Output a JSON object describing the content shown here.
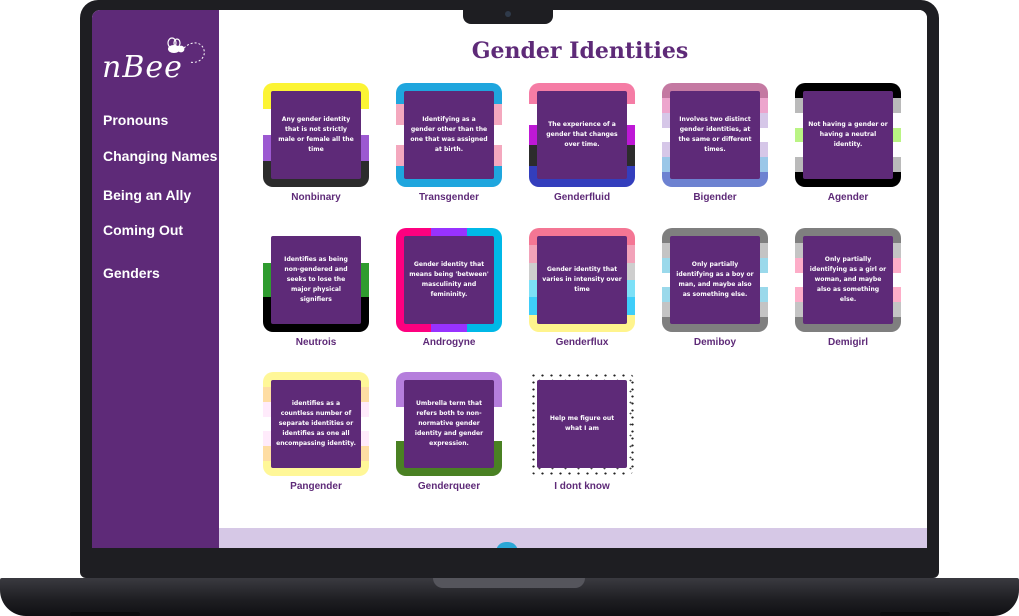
{
  "brand": {
    "logo_text": "nBee"
  },
  "nav": {
    "items": [
      {
        "label": "Pronouns"
      },
      {
        "label": "Changing Names"
      },
      {
        "label": "Being an Ally"
      },
      {
        "label": "Coming Out"
      },
      {
        "label": "Genders"
      }
    ]
  },
  "page": {
    "title": "Gender Identities"
  },
  "colors": {
    "purple": "#5e2a78",
    "footer": "#d6c8e6"
  },
  "cards": [
    {
      "label": "Nonbinary",
      "description": "Any gender identity that is not strictly male or female all the time",
      "flag": [
        "#fcf434",
        "#ffffff",
        "#9c59d1",
        "#2c2c2c"
      ]
    },
    {
      "label": "Transgender",
      "description": "Identifying as a gender other than the one that was assigned at birth.",
      "flag": [
        "#1fa6de",
        "#f4a8be",
        "#ffffff",
        "#f4a8be",
        "#1fa6de"
      ]
    },
    {
      "label": "Genderfluid",
      "description": "The experience of a gender that changes over time.",
      "flag": [
        "#f57ca5",
        "#ffffff",
        "#be18d6",
        "#2c2c2c",
        "#333ebd"
      ]
    },
    {
      "label": "Bigender",
      "description": "Involves two distinct gender identities, at the same or different times.",
      "flag": [
        "#c479a2",
        "#eda5cd",
        "#d6c7e8",
        "#ffffff",
        "#d6c7e8",
        "#9ac7e8",
        "#6d82d1"
      ]
    },
    {
      "label": "Agender",
      "description": "Not having a gender or having a neutral identity.",
      "flag": [
        "#000000",
        "#bababa",
        "#ffffff",
        "#baf484",
        "#ffffff",
        "#bababa",
        "#000000"
      ]
    },
    {
      "label": "Neutrois",
      "description": "Identifies as being non-gendered and seeks to lose the major physical signifiers",
      "flag": [
        "#ffffff",
        "#2f9c2f",
        "#000000"
      ]
    },
    {
      "label": "Androgyne",
      "description": "Gender identity that means being 'between' masculinity and femininity.",
      "flag_vertical": [
        "#fe007f",
        "#9832ff",
        "#00b8e7"
      ]
    },
    {
      "label": "Genderflux",
      "description": "Gender identity that varies in intensity over time",
      "flag": [
        "#f47694",
        "#f2a2b9",
        "#cecece",
        "#7ce0f7",
        "#3ecdf9",
        "#fff48d"
      ]
    },
    {
      "label": "Demiboy",
      "description": "Only partially identifying as a boy or man, and maybe also as something else.",
      "flag": [
        "#7f7f7f",
        "#c4c4c4",
        "#9ad9eb",
        "#ffffff",
        "#9ad9eb",
        "#c4c4c4",
        "#7f7f7f"
      ]
    },
    {
      "label": "Demigirl",
      "description": "Only partially identifying as a girl or woman, and maybe also as something else.",
      "flag": [
        "#7f7f7f",
        "#c4c4c4",
        "#fdadc8",
        "#ffffff",
        "#fdadc8",
        "#c4c4c4",
        "#7f7f7f"
      ]
    },
    {
      "label": "Pangender",
      "description": "identifies as a countless number of separate identities or identifies as one all encompassing identity.",
      "flag": [
        "#fff798",
        "#fedda3",
        "#ffebfb",
        "#ffffff",
        "#ffebfb",
        "#fedda3",
        "#fff798"
      ]
    },
    {
      "label": "Genderqueer",
      "description": "Umbrella term that refers both to non-normative gender identity and gender expression.",
      "flag": [
        "#b57edc",
        "#ffffff",
        "#4a8123"
      ]
    },
    {
      "label": "I dont know",
      "description": "Help me figure out what I am",
      "flag": [
        "speckle"
      ]
    }
  ]
}
